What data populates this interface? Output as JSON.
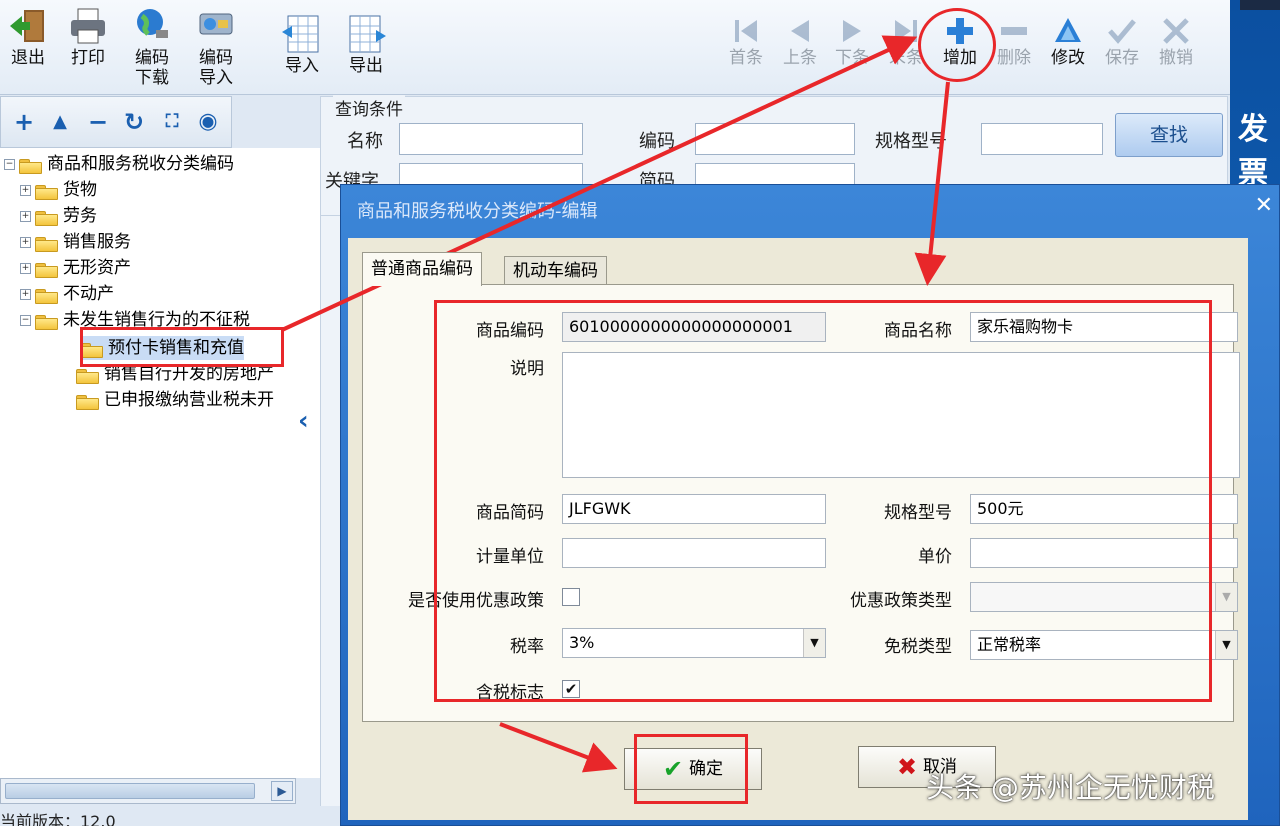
{
  "toolbar": {
    "left": [
      {
        "label": "退出",
        "icon": "exit-icon"
      },
      {
        "label": "打印",
        "icon": "printer-icon"
      },
      {
        "label": "编码\n下载",
        "icon": "globe-icon"
      },
      {
        "label": "编码\n导入",
        "icon": "import-code-icon"
      },
      {
        "label": "导入",
        "icon": "import-icon"
      },
      {
        "label": "导出",
        "icon": "export-icon"
      }
    ],
    "right": [
      {
        "label": "首条",
        "icon": "first-record-icon"
      },
      {
        "label": "上条",
        "icon": "prev-record-icon"
      },
      {
        "label": "下条",
        "icon": "next-record-icon"
      },
      {
        "label": "末条",
        "icon": "last-record-icon"
      },
      {
        "label": "增加",
        "icon": "add-icon"
      },
      {
        "label": "删除",
        "icon": "delete-icon"
      },
      {
        "label": "修改",
        "icon": "edit-icon"
      },
      {
        "label": "保存",
        "icon": "save-icon"
      },
      {
        "label": "撤销",
        "icon": "undo-icon"
      }
    ]
  },
  "sidebar": {
    "brand": "发票"
  },
  "tree": {
    "root": "商品和服务税收分类编码",
    "items": [
      "货物",
      "劳务",
      "销售服务",
      "无形资产",
      "不动产",
      "未发生销售行为的不征税"
    ],
    "children": [
      "预付卡销售和充值",
      "销售自行开发的房地产",
      "已申报缴纳营业税未开"
    ]
  },
  "version": "当前版本：12.0",
  "query": {
    "legend": "查询条件",
    "name_label": "名称",
    "code_label": "编码",
    "spec_label": "规格型号",
    "keyword_label": "关键字",
    "short_label": "简码",
    "search_button": "查找"
  },
  "dialog": {
    "title": "商品和服务税收分类编码-编辑",
    "tabs": [
      "普通商品编码",
      "机动车编码"
    ],
    "fields": {
      "code_label": "商品编码",
      "code_value": "6010000000000000000001",
      "name_label": "商品名称",
      "name_value": "家乐福购物卡",
      "desc_label": "说明",
      "desc_value": "",
      "short_label": "商品简码",
      "short_value": "JLFGWK",
      "spec_label": "规格型号",
      "spec_value": "500元",
      "unit_label": "计量单位",
      "unit_value": "",
      "price_label": "单价",
      "price_value": "",
      "preferential_label": "是否使用优惠政策",
      "preferential_type_label": "优惠政策类型",
      "preferential_type_value": "",
      "tax_rate_label": "税率",
      "tax_rate_value": "3%",
      "exempt_label": "免税类型",
      "exempt_value": "正常税率",
      "tax_included_label": "含税标志"
    },
    "ok_button": "确定",
    "cancel_button": "取消"
  },
  "watermark": "头条 @苏州企无忧财税",
  "colors": {
    "annotation_red": "#e8272a",
    "dialog_blue": "#2a6ec6",
    "accent_blue": "#1a5fb0"
  }
}
